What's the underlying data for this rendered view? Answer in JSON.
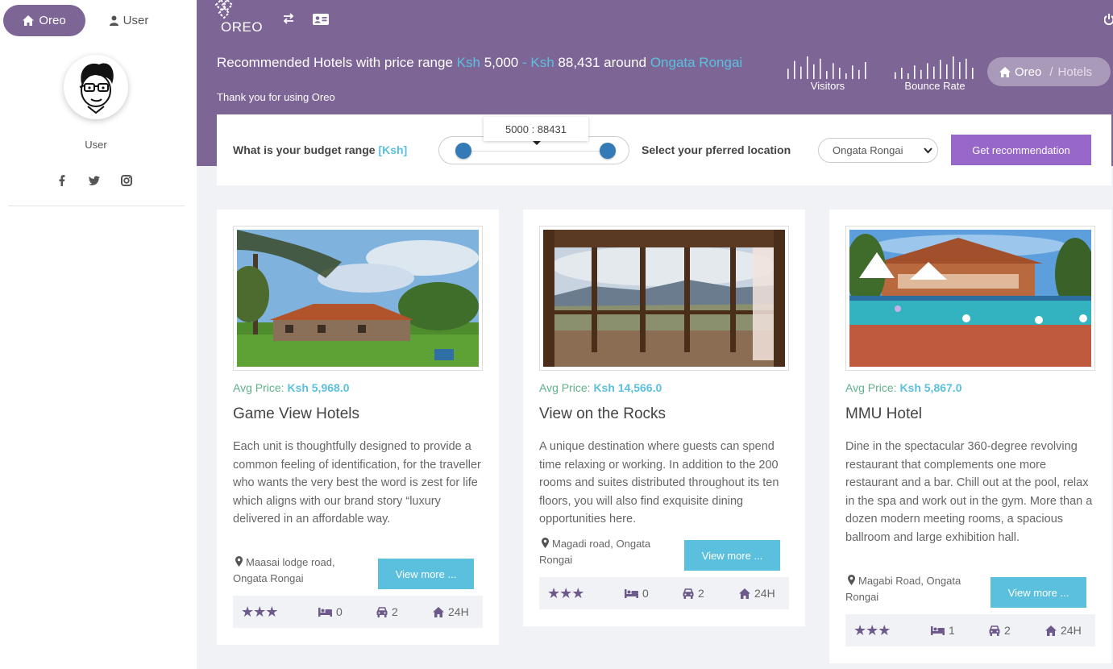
{
  "sidebar": {
    "tabs": [
      {
        "label": "Oreo",
        "icon": "home-icon",
        "active": true
      },
      {
        "label": "User",
        "icon": "person-icon",
        "active": false
      }
    ],
    "user_name": "User",
    "socials": [
      "facebook-icon",
      "twitter-icon",
      "instagram-icon"
    ]
  },
  "header": {
    "logo_text": "OREO",
    "title_prefix": "Recommended Hotels with price range",
    "currency": "Ksh",
    "min_price": "5,000",
    "dash": "-",
    "max_price": "88,431",
    "around": "around",
    "location": "Ongata Rongai",
    "subtitle": "Thank you for using Oreo",
    "stats": [
      {
        "label": "Visitors",
        "bars": [
          0.45,
          0.8,
          0.55,
          1.0,
          0.65,
          0.9,
          0.35,
          0.7,
          0.5,
          0.25,
          0.6,
          0.4,
          0.75
        ]
      },
      {
        "label": "Bounce Rate",
        "bars": [
          0.3,
          0.5,
          0.25,
          0.6,
          0.4,
          0.7,
          0.55,
          0.85,
          0.65,
          1.0,
          0.75,
          0.9,
          0.5
        ]
      }
    ],
    "breadcrumb": {
      "home": "Oreo",
      "separator": "/",
      "current": "Hotels"
    }
  },
  "filter": {
    "budget_label": "What is your budget range",
    "budget_unit": "[Ksh]",
    "slider_tooltip": "5000 : 88431",
    "location_label": "Select your pferred location",
    "location_value": "Ongata Rongai",
    "button_label": "Get recommendation"
  },
  "hotels": [
    {
      "price_label": "Avg Price:",
      "price": "Ksh 5,968.0",
      "name": "Game View Hotels",
      "description": "Each unit is thoughtfully designed to provide a common feeling of identification, for the traveller who wants the very best the word is zest for life which aligns with our brand story “luxury delivered in an affordable way.",
      "address": "Maasai lodge road, Ongata Rongai",
      "button": "View more ...",
      "stars": "★★★",
      "beds": "0",
      "cars": "2",
      "hours": "24H"
    },
    {
      "price_label": "Avg Price:",
      "price": "Ksh 14,566.0",
      "name": "View on the Rocks",
      "description": "A unique destination where guests can spend time relaxing or working. In addition to the 200 rooms and suites distributed throughout its ten floors, you will also find exquisite dining opportunities here.",
      "address": "Magadi road, Ongata Rongai",
      "button": "View more ...",
      "stars": "★★★",
      "beds": "0",
      "cars": "2",
      "hours": "24H"
    },
    {
      "price_label": "Avg Price:",
      "price": "Ksh 5,867.0",
      "name": "MMU Hotel",
      "description": "Dine in the spectacular 360-degree revolving restaurant that complements one more restaurant and a bar. Chill out at the pool, relax in the spa and work out in the gym. More than a dozen modern meeting rooms, a spacious ballroom and large exhibition hall.",
      "address": "Magabi Road, Ongata Rongai",
      "button": "View more ...",
      "stars": "★★★",
      "beds": "1",
      "cars": "2",
      "hours": "24H"
    }
  ],
  "colors": {
    "brand_purple": "#7d6596",
    "accent_blue": "#5bc0de",
    "button_purple": "#9768c9",
    "price_green": "#5fb08b"
  }
}
